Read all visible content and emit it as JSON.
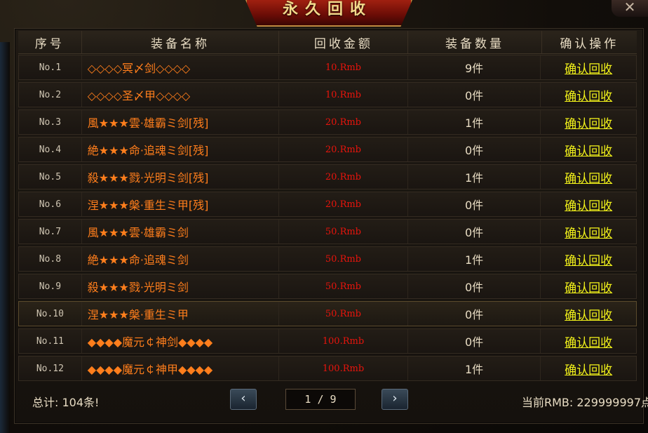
{
  "title": "永久回收",
  "close_label": "✕",
  "headers": {
    "no": "序号",
    "name": "装备名称",
    "price": "回收金额",
    "qty": "装备数量",
    "action": "确认操作"
  },
  "rows": [
    {
      "no": "No.1",
      "name": "◇◇◇◇冥〆剑◇◇◇◇",
      "price": "10.Rmb",
      "qty": "9件",
      "action": "确认回收"
    },
    {
      "no": "No.2",
      "name": "◇◇◇◇圣〆甲◇◇◇◇",
      "price": "10.Rmb",
      "qty": "0件",
      "action": "确认回收"
    },
    {
      "no": "No.3",
      "name": "風★★★雲·雄霸ミ剑[残]",
      "price": "20.Rmb",
      "qty": "1件",
      "action": "确认回收"
    },
    {
      "no": "No.4",
      "name": "絶★★★命·追魂ミ剑[残]",
      "price": "20.Rmb",
      "qty": "0件",
      "action": "确认回收"
    },
    {
      "no": "No.5",
      "name": "殺★★★戮·光明ミ剑[残]",
      "price": "20.Rmb",
      "qty": "1件",
      "action": "确认回收"
    },
    {
      "no": "No.6",
      "name": "涅★★★槃·重生ミ甲[残]",
      "price": "20.Rmb",
      "qty": "0件",
      "action": "确认回收"
    },
    {
      "no": "No.7",
      "name": "風★★★雲·雄霸ミ剑",
      "price": "50.Rmb",
      "qty": "0件",
      "action": "确认回收"
    },
    {
      "no": "No.8",
      "name": "絶★★★命·追魂ミ剑",
      "price": "50.Rmb",
      "qty": "1件",
      "action": "确认回收"
    },
    {
      "no": "No.9",
      "name": "殺★★★戮·光明ミ剑",
      "price": "50.Rmb",
      "qty": "0件",
      "action": "确认回收"
    },
    {
      "no": "No.10",
      "name": "涅★★★槃·重生ミ甲",
      "price": "50.Rmb",
      "qty": "0件",
      "action": "确认回收"
    },
    {
      "no": "No.11",
      "name": "◆◆◆◆魔元￠神剑◆◆◆◆",
      "price": "100.Rmb",
      "qty": "0件",
      "action": "确认回收"
    },
    {
      "no": "No.12",
      "name": "◆◆◆◆魔元￠神甲◆◆◆◆",
      "price": "100.Rmb",
      "qty": "1件",
      "action": "确认回收"
    }
  ],
  "footer": {
    "total": "总计: 104条!",
    "prev_icon": "‹",
    "next_icon": "›",
    "page": "1 / 9",
    "rmb": "当前RMB: 229999997点"
  },
  "colors": {
    "name": "#ff7e1c",
    "price": "#e8140c",
    "action": "#f2f21a",
    "title": "#f3d98a"
  }
}
